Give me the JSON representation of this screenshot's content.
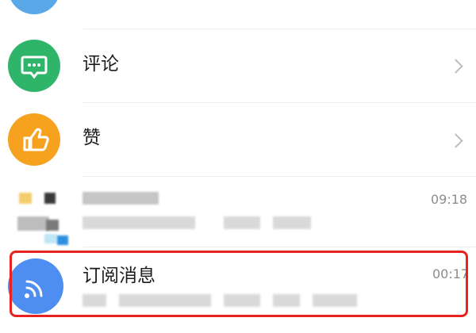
{
  "rows": {
    "comments": {
      "label": "评论",
      "icon": "chat-bubble-icon",
      "icon_color": "#2fb56a"
    },
    "likes": {
      "label": "赞",
      "icon": "thumbs-up-icon",
      "icon_color": "#f6a21e"
    },
    "chat": {
      "time": "09:18"
    },
    "subscription": {
      "label": "订阅消息",
      "time": "00:17",
      "icon": "rss-icon",
      "icon_color": "#4d8ef0"
    }
  },
  "highlight_color": "#e8231f"
}
